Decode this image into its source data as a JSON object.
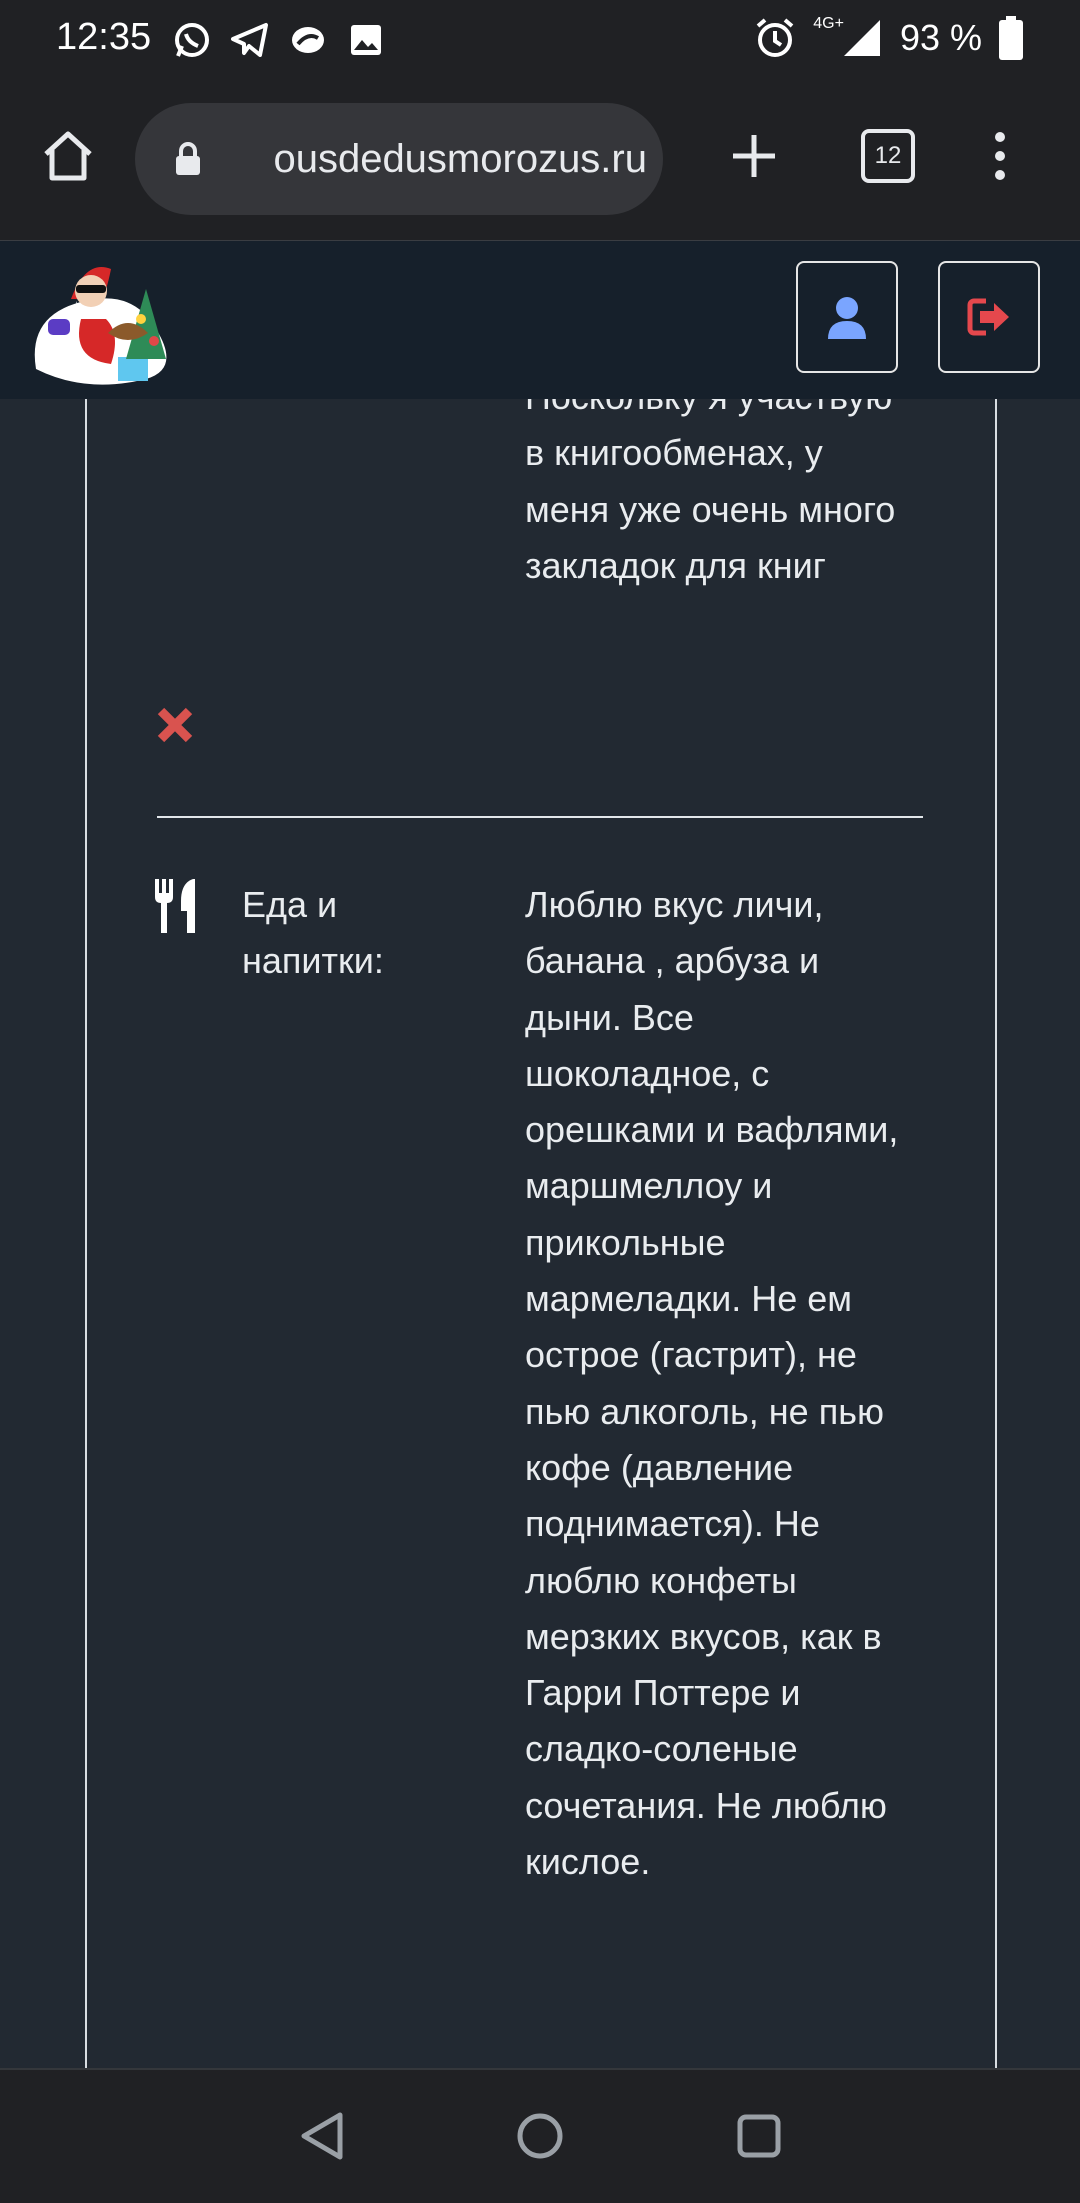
{
  "status_bar": {
    "time": "12:35",
    "network": "4G+",
    "battery": "93 %",
    "notification_icons": [
      "whatsapp-icon",
      "telegram-icon",
      "app-icon",
      "gallery-icon"
    ]
  },
  "browser": {
    "url": "ousdedusmorozus.ru",
    "tab_count": "12"
  },
  "site_header": {
    "logo_icon": "santa-logo-icon",
    "profile_icon": "user-icon",
    "logout_icon": "sign-out-icon",
    "profile_color": "#7aa5ff",
    "logout_color": "#e5484d"
  },
  "content": {
    "previous_entry_text": "Поскольку я участвую в книгообменах, у меня уже очень много закладок для книг",
    "remove_icon": "remove-x-icon",
    "remove_color": "#d9534f",
    "entry": {
      "icon": "utensils-icon",
      "category": "Еда и напитки:",
      "text": "Люблю вкус личи, банана , арбуза и дыни. Все шоколадное, с орешками и вафлями, маршмеллоу и прикольные мармеладки. Не ем острое (гастрит), не пью алкоголь, не пью кофе (давление поднимается). Не люблю конфеты мерзких вкусов, как в Гарри Поттере и сладко-соленые сочетания. Не люблю кислое."
    }
  },
  "nav_bar": {
    "back_icon": "back-triangle-icon",
    "home_icon": "home-circle-icon",
    "recents_icon": "recents-square-icon"
  }
}
